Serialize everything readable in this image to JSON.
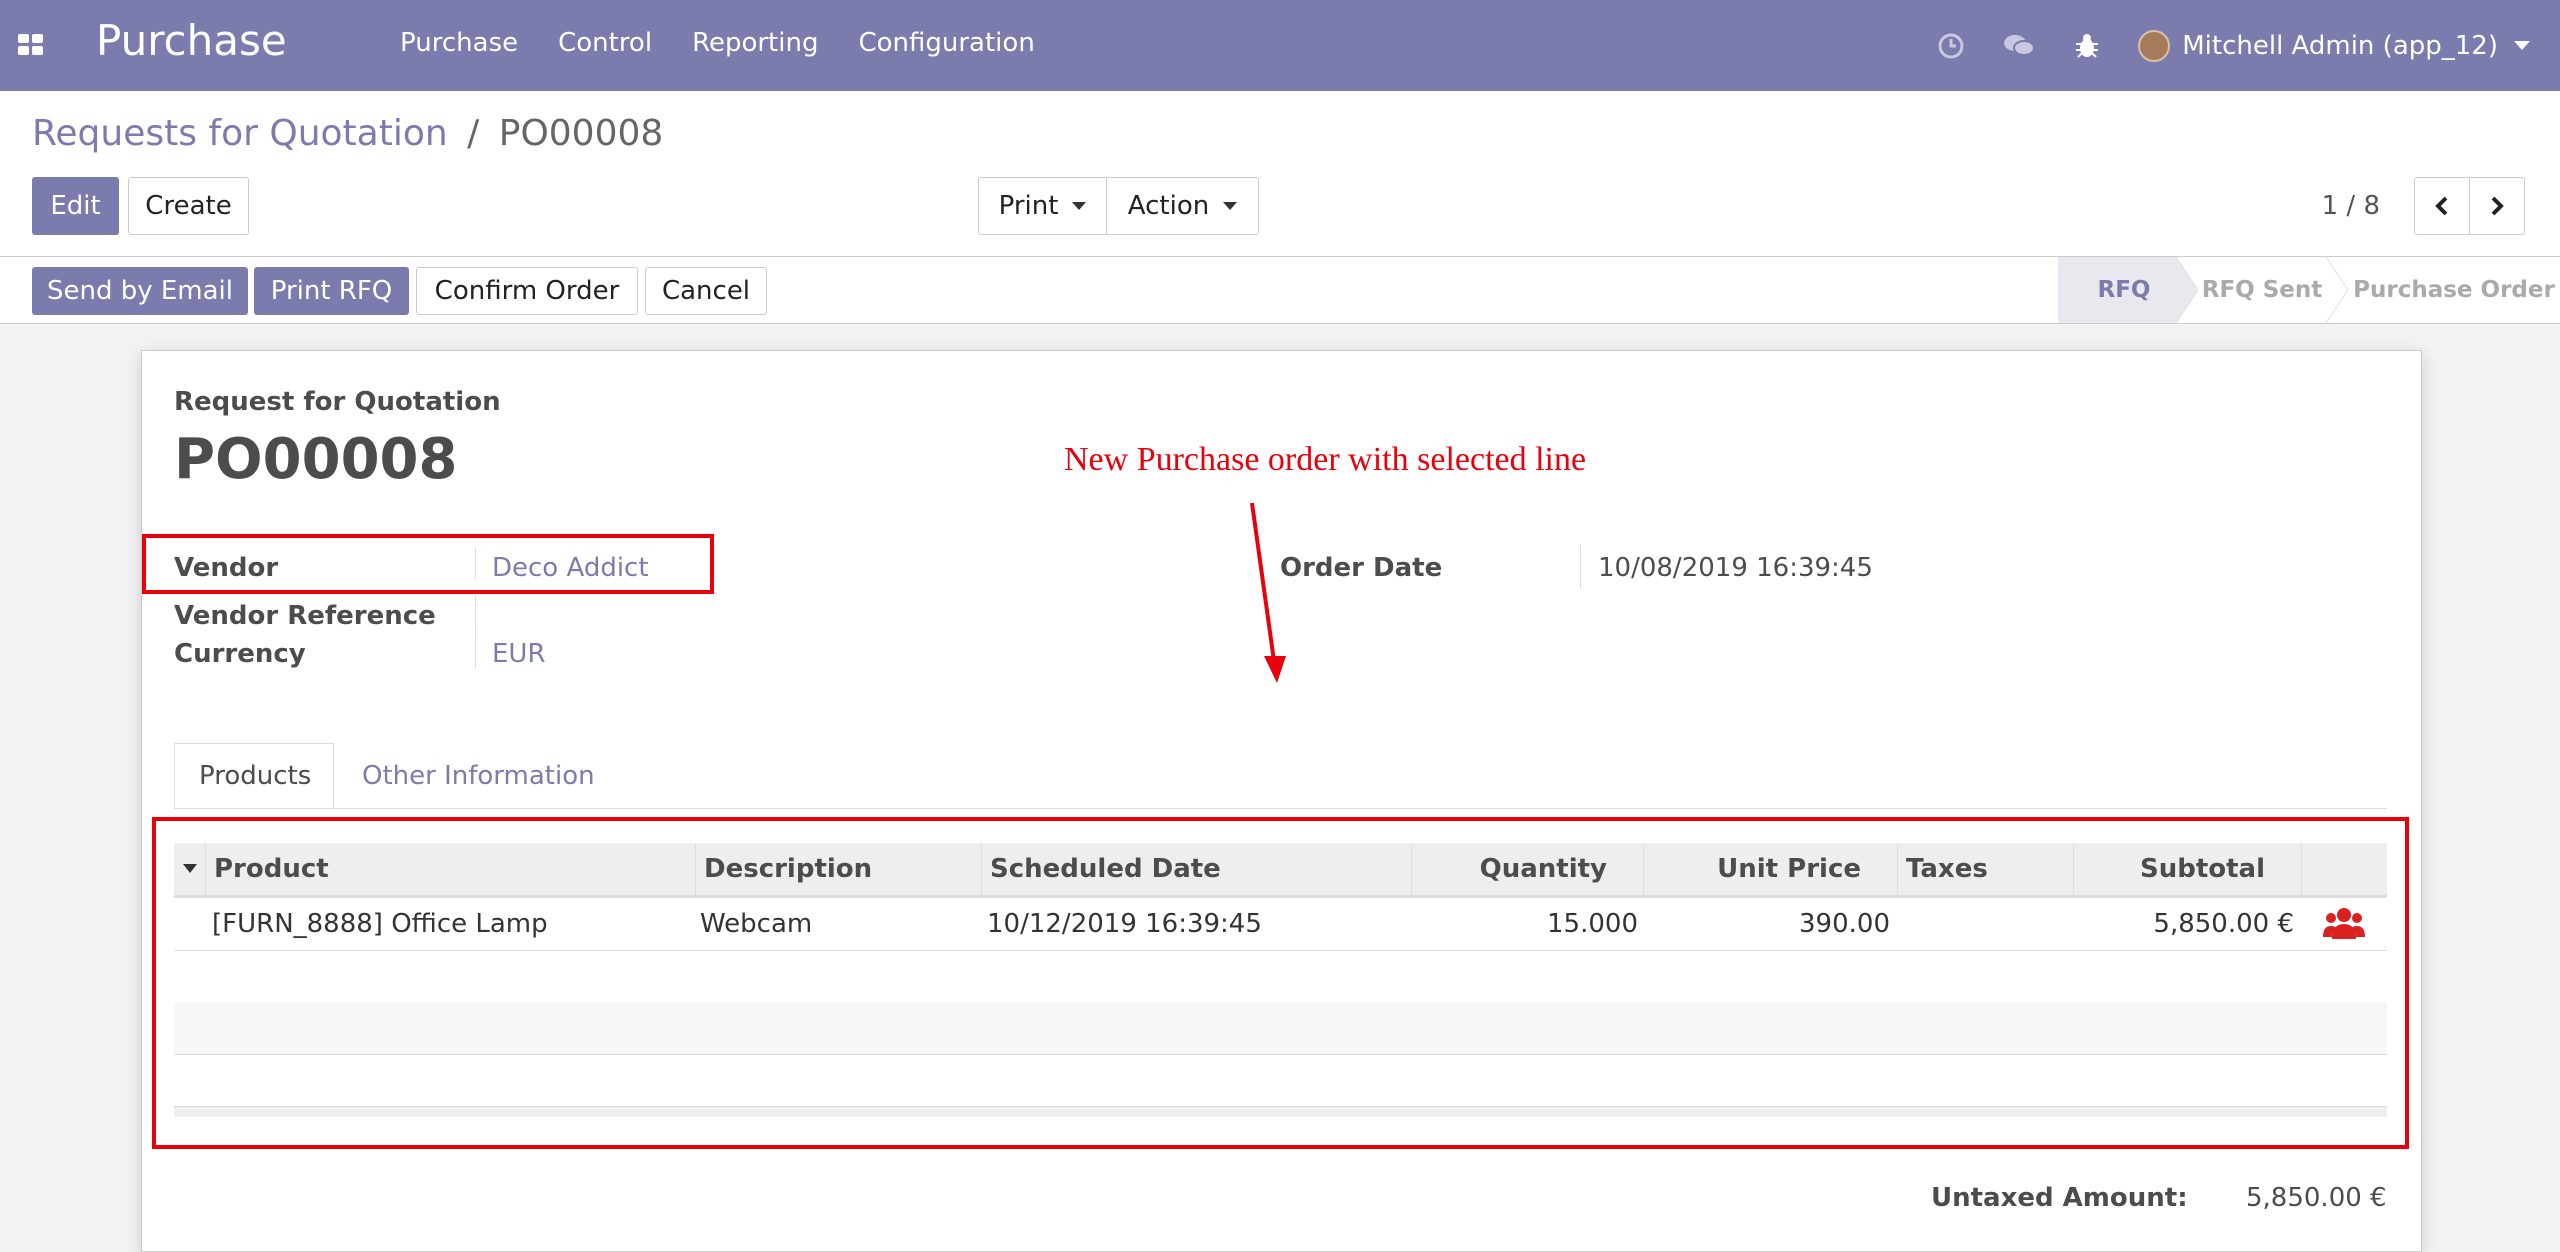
{
  "navbar": {
    "app_title": "Purchase",
    "menu": [
      "Purchase",
      "Control",
      "Reporting",
      "Configuration"
    ],
    "user_name": "Mitchell Admin (app_12)",
    "icons": [
      "apps-icon",
      "clock-icon",
      "chat-icon",
      "bug-icon"
    ],
    "color": "#7c7bad"
  },
  "breadcrumb": {
    "parent": "Requests for Quotation",
    "separator": "/",
    "current": "PO00008"
  },
  "buttons": {
    "edit": "Edit",
    "create": "Create",
    "print": "Print",
    "action": "Action",
    "send_email": "Send by Email",
    "print_rfq": "Print RFQ",
    "confirm_order": "Confirm Order",
    "cancel": "Cancel"
  },
  "pager": {
    "value": "1 / 8"
  },
  "stages": [
    "RFQ",
    "RFQ Sent",
    "Purchase Order"
  ],
  "active_stage": "RFQ",
  "form": {
    "type_label": "Request for Quotation",
    "name": "PO00008",
    "vendor_label": "Vendor",
    "vendor_value": "Deco Addict",
    "vendor_ref_label": "Vendor Reference",
    "currency_label": "Currency",
    "currency_value": "EUR",
    "order_date_label": "Order Date",
    "order_date_value": "10/08/2019 16:39:45"
  },
  "annotation": "New Purchase order with selected line",
  "tabs": [
    "Products",
    "Other Information"
  ],
  "table": {
    "headers": [
      "Product",
      "Description",
      "Scheduled Date",
      "Quantity",
      "Unit Price",
      "Taxes",
      "Subtotal"
    ],
    "rows": [
      {
        "product": "[FURN_8888] Office Lamp",
        "description": "Webcam",
        "scheduled_date": "10/12/2019 16:39:45",
        "quantity": "15.000",
        "unit_price": "390.00",
        "taxes": "",
        "subtotal": "5,850.00 €"
      }
    ]
  },
  "totals": {
    "untaxed_label": "Untaxed Amount:",
    "untaxed_value": "5,850.00 €"
  }
}
